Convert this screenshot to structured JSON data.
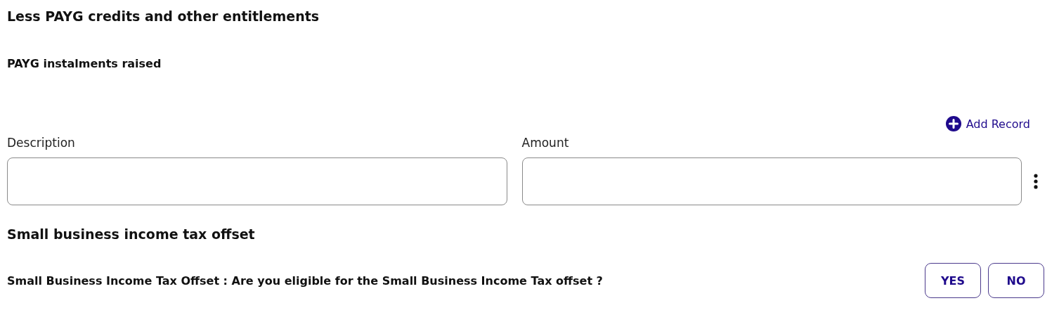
{
  "section_title": "Less PAYG credits and other entitlements",
  "subsection_title": "PAYG instalments raised",
  "add_record": {
    "label": "Add Record"
  },
  "fields": [
    {
      "label": "Description"
    },
    {
      "label": "Amount"
    }
  ],
  "offset_title": "Small business income tax offset",
  "question": "Small Business Income Tax Offset : Are you eligible for the Small Business Income Tax offset ?",
  "choices": [
    {
      "label": "YES",
      "selected": false
    },
    {
      "label": "NO",
      "selected": false
    }
  ]
}
